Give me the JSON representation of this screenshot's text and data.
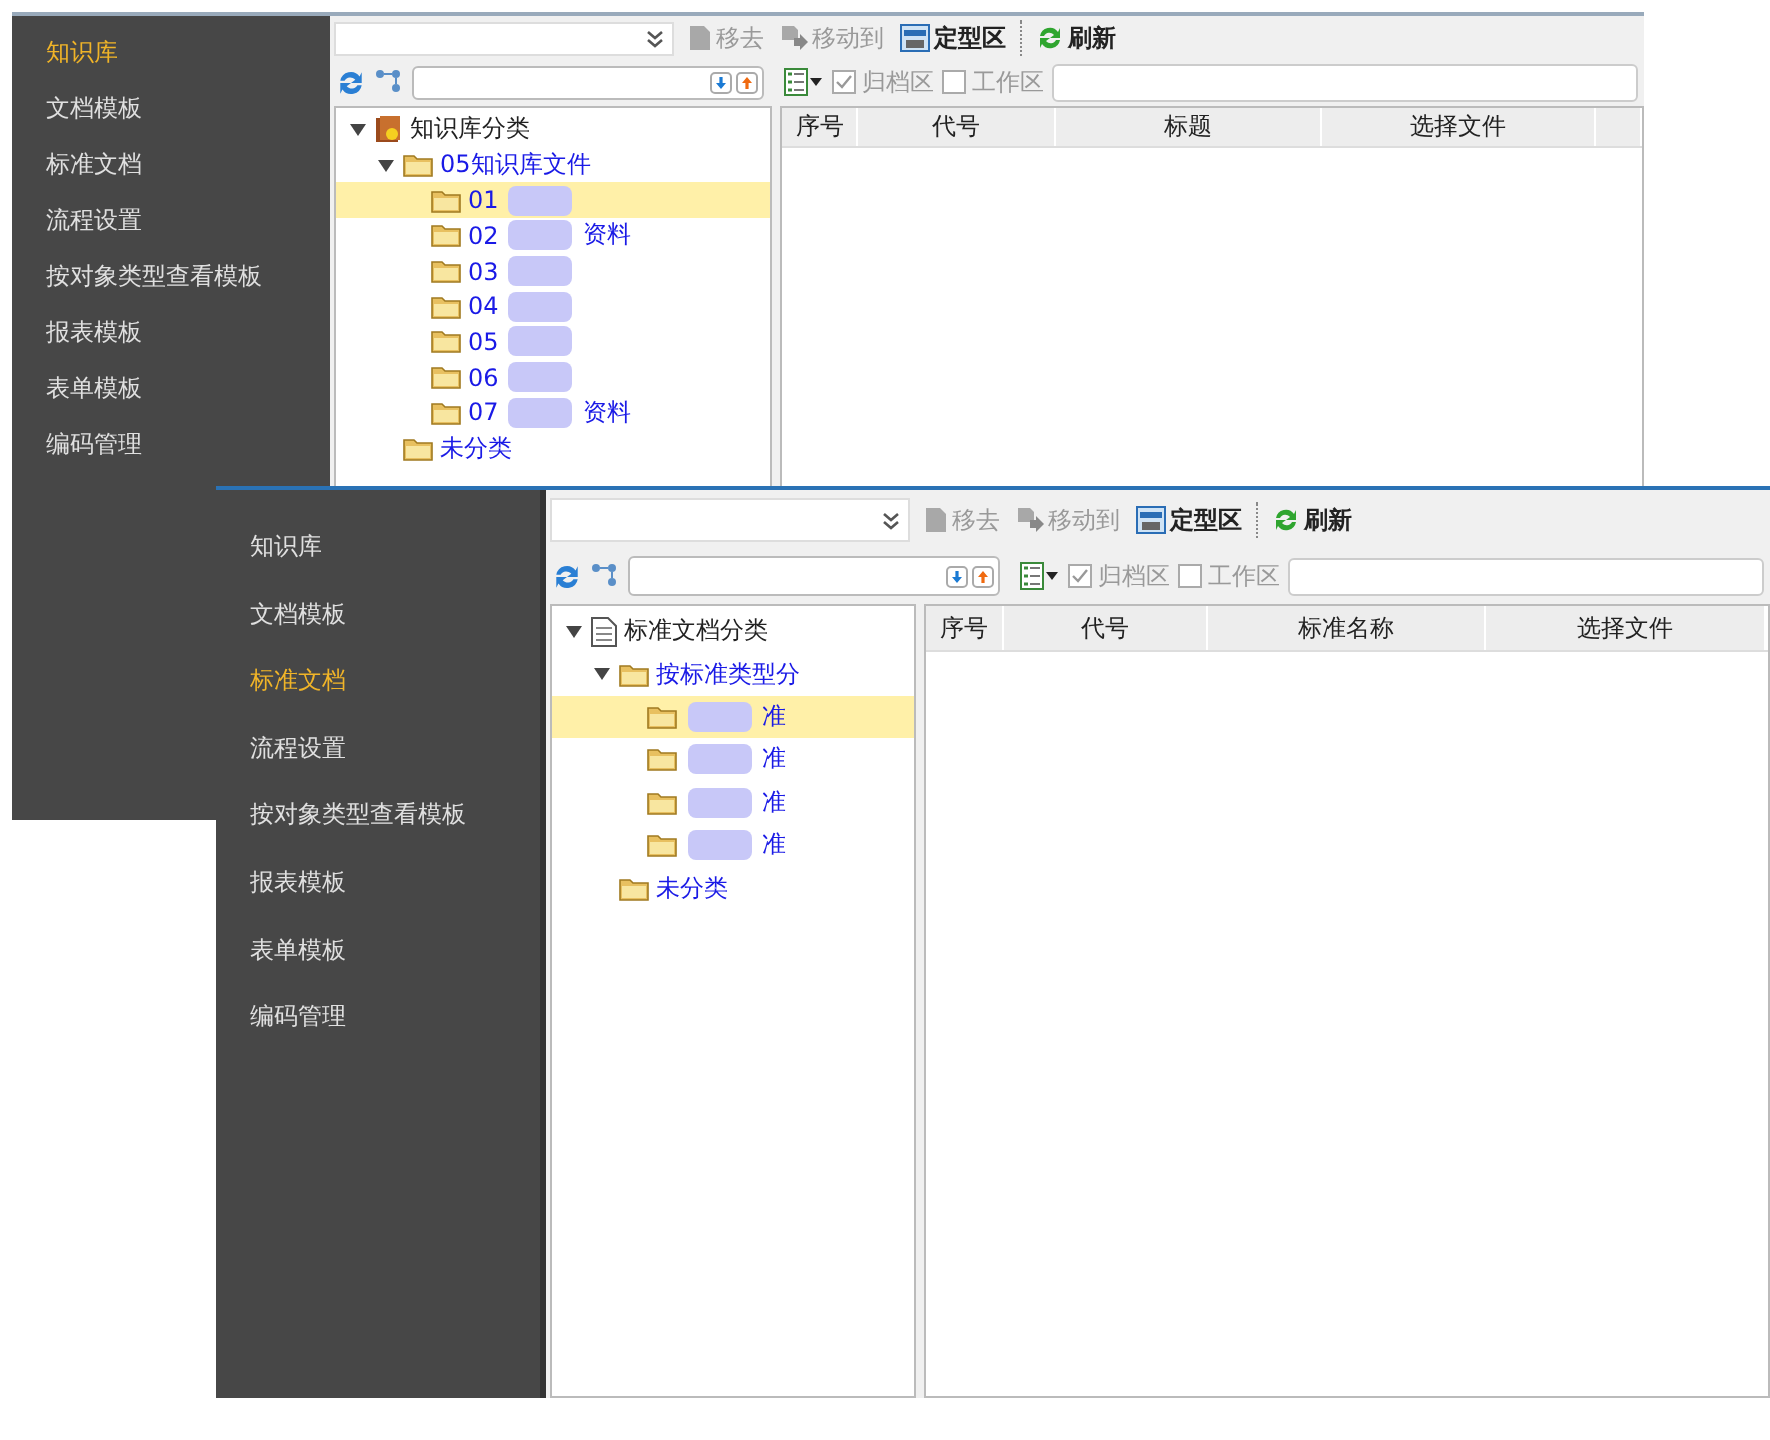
{
  "windows": [
    {
      "sidebar": [
        {
          "label": "知识库",
          "selected": true
        },
        {
          "label": "文档模板",
          "selected": false
        },
        {
          "label": "标准文档",
          "selected": false
        },
        {
          "label": "流程设置",
          "selected": false
        },
        {
          "label": "按对象类型查看模板",
          "selected": false
        },
        {
          "label": "报表模板",
          "selected": false
        },
        {
          "label": "表单模板",
          "selected": false
        },
        {
          "label": "编码管理",
          "selected": false
        }
      ],
      "toolbar": [
        {
          "kind": "remove",
          "label": "移去",
          "disabled": true
        },
        {
          "kind": "move",
          "label": "移动到",
          "disabled": true
        },
        {
          "kind": "fixed",
          "label": "定型区",
          "disabled": false
        },
        {
          "kind": "refresh",
          "label": "刷新",
          "disabled": false
        }
      ],
      "checks": [
        {
          "label": "归档区",
          "checked": true
        },
        {
          "label": "工作区",
          "checked": false
        }
      ],
      "tree": {
        "label": "知识库分类",
        "kind": "book",
        "expanded": true,
        "selected": false,
        "children": [
          {
            "label": "05知识库文件",
            "expanded": true,
            "selected": false,
            "children": [
              {
                "label": "01",
                "redacted": true,
                "selected": true
              },
              {
                "label": "02",
                "suffix": "资料",
                "redacted": true,
                "selected": false
              },
              {
                "label": "03",
                "redacted": true,
                "selected": false
              },
              {
                "label": "04",
                "redacted": true,
                "selected": false
              },
              {
                "label": "05",
                "redacted": true,
                "selected": false
              },
              {
                "label": "06",
                "redacted": true,
                "selected": false
              },
              {
                "label": "07",
                "suffix": "资料",
                "redacted": true,
                "selected": false
              }
            ]
          },
          {
            "label": "未分类",
            "selected": false
          }
        ]
      },
      "columns": [
        "序号",
        "代号",
        "标题",
        "选择文件"
      ]
    },
    {
      "sidebar": [
        {
          "label": "知识库",
          "selected": false
        },
        {
          "label": "文档模板",
          "selected": false
        },
        {
          "label": "标准文档",
          "selected": true
        },
        {
          "label": "流程设置",
          "selected": false
        },
        {
          "label": "按对象类型查看模板",
          "selected": false
        },
        {
          "label": "报表模板",
          "selected": false
        },
        {
          "label": "表单模板",
          "selected": false
        },
        {
          "label": "编码管理",
          "selected": false
        }
      ],
      "toolbar": [
        {
          "kind": "remove",
          "label": "移去",
          "disabled": true
        },
        {
          "kind": "move",
          "label": "移动到",
          "disabled": true
        },
        {
          "kind": "fixed",
          "label": "定型区",
          "disabled": false
        },
        {
          "kind": "refresh",
          "label": "刷新",
          "disabled": false
        }
      ],
      "checks": [
        {
          "label": "归档区",
          "checked": true
        },
        {
          "label": "工作区",
          "checked": false
        }
      ],
      "tree": {
        "label": "标准文档分类",
        "kind": "document",
        "expanded": true,
        "selected": false,
        "children": [
          {
            "label": "按标准类型分",
            "expanded": true,
            "selected": false,
            "children": [
              {
                "suffix": "准",
                "redacted": true,
                "selected": true
              },
              {
                "suffix": "准",
                "redacted": true,
                "selected": false
              },
              {
                "suffix": "准",
                "redacted": true,
                "selected": false
              },
              {
                "suffix": "准",
                "redacted": true,
                "selected": false
              }
            ]
          },
          {
            "label": "未分类",
            "selected": false
          }
        ]
      },
      "columns": [
        "序号",
        "代号",
        "标准名称",
        "选择文件"
      ]
    }
  ]
}
